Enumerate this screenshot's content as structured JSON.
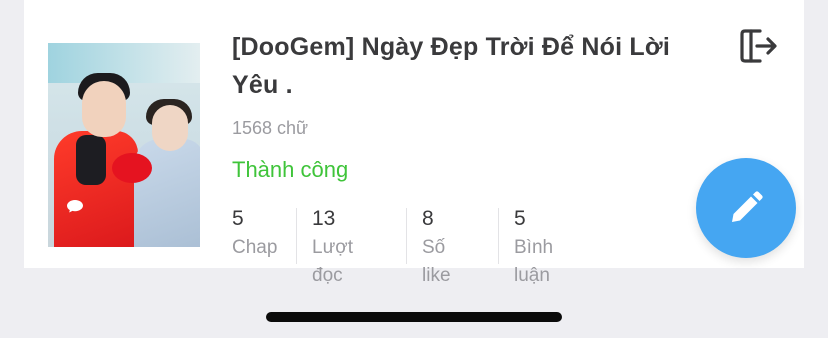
{
  "story": {
    "title": "[DooGem] Ngày Đẹp Trời Để Nói Lời Yêu .",
    "word_count": "1568 chữ",
    "status": "Thành công",
    "status_color": "#3fc43a"
  },
  "stats": [
    {
      "value": "5",
      "label": "Chap"
    },
    {
      "value": "13",
      "label": "Lượt đọc"
    },
    {
      "value": "8",
      "label": "Số like"
    },
    {
      "value": "5",
      "label": "Bình luận"
    }
  ],
  "icons": {
    "exit": "exit-icon",
    "edit": "pencil-icon",
    "cover_chat": "chat-bubble-icon"
  },
  "colors": {
    "accent": "#45a6f2",
    "title": "#3a3a3c",
    "muted": "#9b9ba0"
  }
}
